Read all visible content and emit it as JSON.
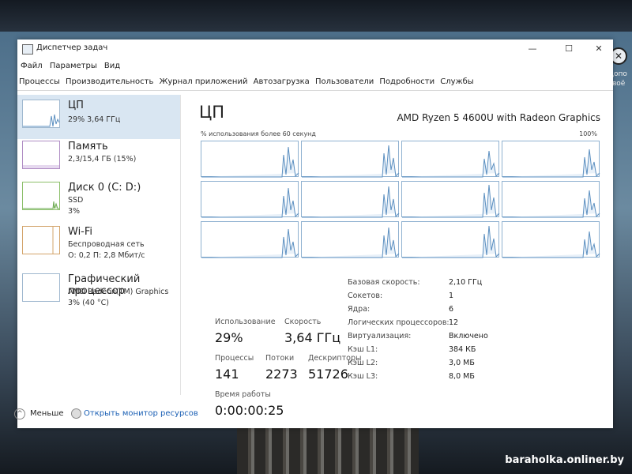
{
  "window": {
    "title": "Диспетчер задач",
    "minimize": "—",
    "maximize": "☐",
    "close": "✕"
  },
  "menu": [
    "Файл",
    "Параметры",
    "Вид"
  ],
  "tabs": [
    "Процессы",
    "Производительность",
    "Журнал приложений",
    "Автозагрузка",
    "Пользователи",
    "Подробности",
    "Службы"
  ],
  "sidebar": [
    {
      "title": "ЦП",
      "sub1": "29%  3,64 ГГц",
      "sub2": "",
      "sub3": "",
      "selected": true
    },
    {
      "title": "Память",
      "sub1": "2,3/15,4 ГБ (15%)",
      "sub2": "",
      "sub3": ""
    },
    {
      "title": "Диск 0 (C: D:)",
      "sub1": "SSD",
      "sub2": "3%",
      "sub3": ""
    },
    {
      "title": "Wi-Fi",
      "sub1": "Беспроводная сеть",
      "sub2": "О: 0,2  П: 2,8 Мбит/с",
      "sub3": ""
    },
    {
      "title": "Графический процессор",
      "sub1": "AMD Radeon(TM) Graphics",
      "sub2": "3% (40 °C)",
      "sub3": ""
    }
  ],
  "main": {
    "title": "ЦП",
    "model": "AMD Ryzen 5 4600U with Radeon Graphics",
    "graph_caption": "% использования более 60 секунд",
    "graph_max": "100%",
    "stats": {
      "usage_label": "Использование",
      "usage_value": "29%",
      "speed_label": "Скорость",
      "speed_value": "3,64 ГГц",
      "processes_label": "Процессы",
      "processes_value": "141",
      "threads_label": "Потоки",
      "threads_value": "2273",
      "handles_label": "Дескрипторы",
      "handles_value": "51726",
      "uptime_label": "Время работы",
      "uptime_value": "0:00:00:25"
    },
    "properties": [
      {
        "key": "Базовая скорость:",
        "value": "2,10 ГГц"
      },
      {
        "key": "Сокетов:",
        "value": "1"
      },
      {
        "key": "Ядра:",
        "value": "6"
      },
      {
        "key": "Логических процессоров:",
        "value": "12"
      },
      {
        "key": "Виртуализация:",
        "value": "Включено"
      },
      {
        "key": "Кэш L1:",
        "value": "384 КБ"
      },
      {
        "key": "Кэш L2:",
        "value": "3,0 МБ"
      },
      {
        "key": "Кэш L3:",
        "value": "8,0 МБ"
      }
    ]
  },
  "footer": {
    "less": "Меньше",
    "resource_monitor": "Открыть монитор ресурсов"
  },
  "desktop": {
    "side_text": "Допо своё",
    "watermark": "baraholka.onliner.by"
  },
  "colors": {
    "accent": "#1a5fb4",
    "graph_line": "#5b8fc0",
    "graph_border": "#8fb1d0",
    "selected_bg": "#d9e6f2"
  }
}
